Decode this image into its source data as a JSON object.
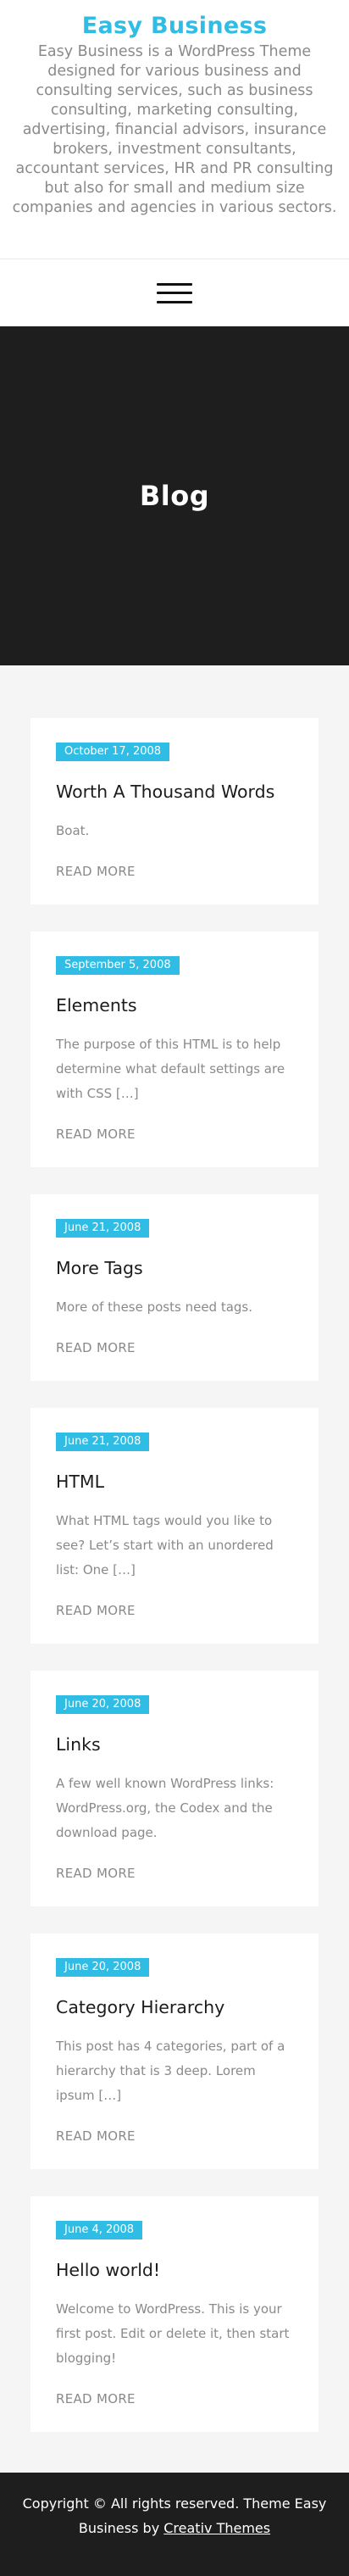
{
  "header": {
    "site_title": "Easy Business",
    "site_description": "Easy Business is a WordPress Theme designed for various business and consulting services, such as business consulting, marketing consulting, advertising, financial advisors, insurance brokers, investment consultants, accountant services, HR and PR consulting but also for small and medium size companies and agencies in various sectors."
  },
  "nav": {
    "menu_icon": "hamburger-icon"
  },
  "hero": {
    "title": "Blog"
  },
  "posts": [
    {
      "date": "October 17, 2008",
      "title": "Worth A Thousand Words",
      "excerpt": "Boat.",
      "read_more": "READ MORE"
    },
    {
      "date": "September 5, 2008",
      "title": "Elements",
      "excerpt": "The purpose of this HTML is to help determine what default settings are with CSS […]",
      "read_more": "READ MORE"
    },
    {
      "date": "June 21, 2008",
      "title": "More Tags",
      "excerpt": "More of these posts need tags.",
      "read_more": "READ MORE"
    },
    {
      "date": "June 21, 2008",
      "title": "HTML",
      "excerpt": "What HTML tags would you like to see? Let’s start with an unordered list: One […]",
      "read_more": "READ MORE"
    },
    {
      "date": "June 20, 2008",
      "title": "Links",
      "excerpt": "A few well known WordPress links: WordPress.org, the Codex and the download page.",
      "read_more": "READ MORE"
    },
    {
      "date": "June 20, 2008",
      "title": "Category Hierarchy",
      "excerpt": "This post has 4 categories, part of a hierarchy that is 3 deep. Lorem ipsum […]",
      "read_more": "READ MORE"
    },
    {
      "date": "June 4, 2008",
      "title": "Hello world!",
      "excerpt": "Welcome to WordPress. This is your first post. Edit or delete it, then start blogging!",
      "read_more": "READ MORE"
    }
  ],
  "footer": {
    "copyright_text": "Copyright © All rights reserved. Theme Easy Business by ",
    "author_link": "Creativ Themes"
  },
  "colors": {
    "accent": "#2fbde6",
    "dark": "#1e1e1e",
    "page_bg": "#f5f5f5",
    "muted_text": "#8a8a8a"
  }
}
